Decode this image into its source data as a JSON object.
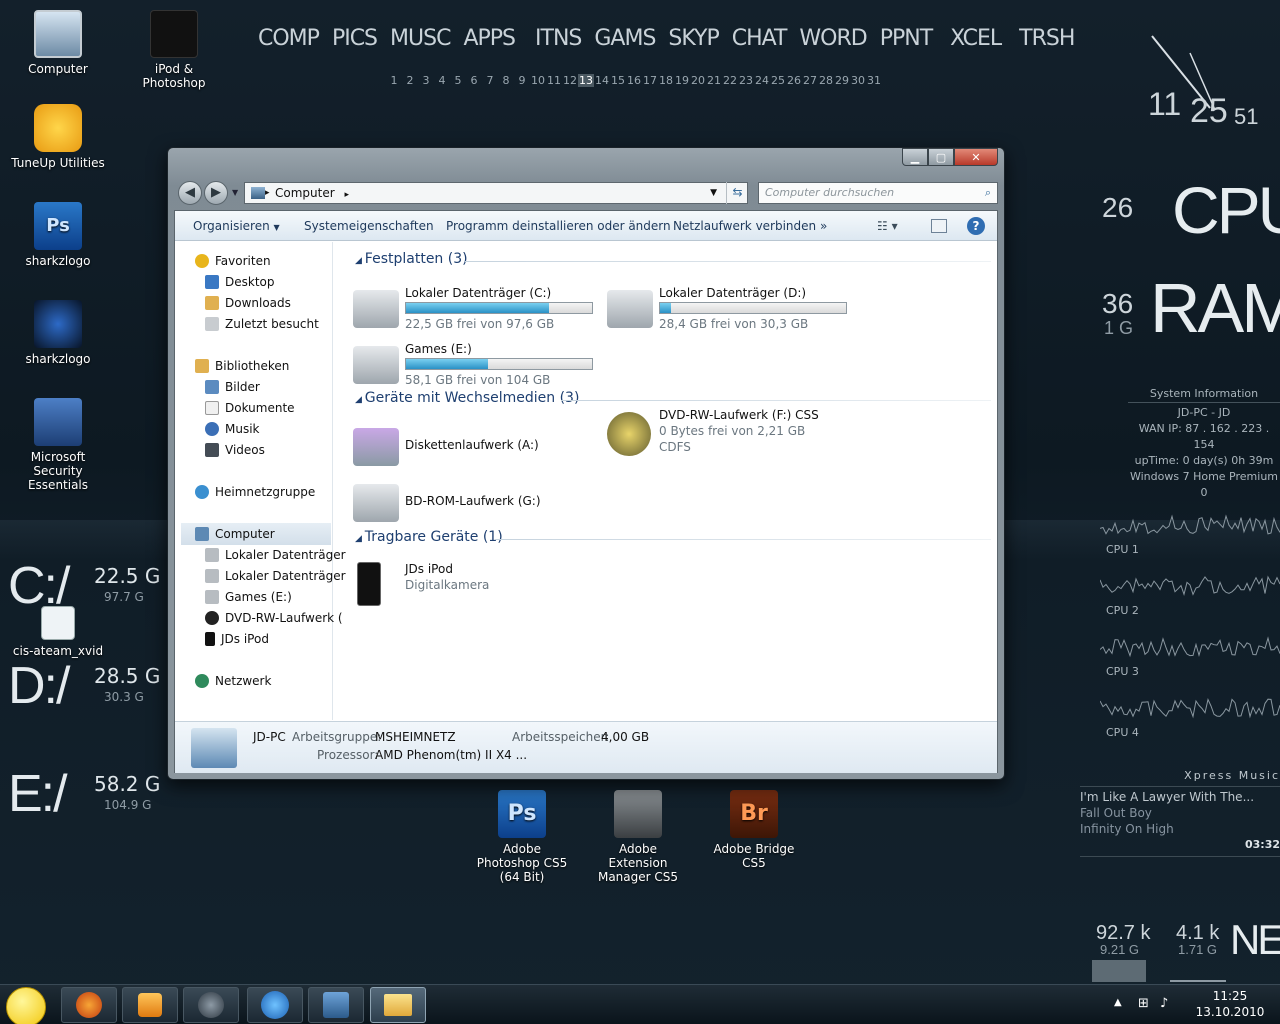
{
  "desktop_icons": [
    {
      "label": "Computer"
    },
    {
      "label": "iPod & Photoshop"
    },
    {
      "label": "TuneUp Utilities"
    },
    {
      "label": "sharkzlogo"
    },
    {
      "label": "sharkzlogo"
    },
    {
      "label": "Microsoft Security Essentials"
    },
    {
      "label": "cis-ateam_xvid"
    },
    {
      "label": "Adobe Photoshop CS5 (64 Bit)"
    },
    {
      "label": "Adobe Extension Manager CS5"
    },
    {
      "label": "Adobe Bridge CS5"
    }
  ],
  "topnav": [
    "COMP",
    "PICS",
    "MUSC",
    "APPS",
    "ITNS",
    "GAMS",
    "SKYP",
    "CHAT",
    "WORD",
    "PPNT",
    "XCEL",
    "TRSH"
  ],
  "days": [
    "1",
    "2",
    "3",
    "4",
    "5",
    "6",
    "7",
    "8",
    "9",
    "10",
    "11",
    "12",
    "13",
    "14",
    "15",
    "16",
    "17",
    "18",
    "19",
    "20",
    "21",
    "22",
    "23",
    "24",
    "25",
    "26",
    "27",
    "28",
    "29",
    "30",
    "31"
  ],
  "today": "13",
  "clock": {
    "hour": "11",
    "minute": "25",
    "second": "51"
  },
  "gauges": {
    "cpu_value": "26",
    "cpu_label": "CPU",
    "ram_value": "36",
    "ram_total": "1 G",
    "ram_label": "RAM"
  },
  "sysinfo": {
    "header": "System Information",
    "host": "JD-PC - JD",
    "wan": "WAN IP: 87 . 162 . 223 . 154",
    "uptime": "upTime: 0 day(s) 0h 39m",
    "os": "Windows 7 Home Premium",
    "extra": "0"
  },
  "cpu_graphs": [
    "CPU 1",
    "CPU 2",
    "CPU 3",
    "CPU 4"
  ],
  "music": {
    "header": "Xpress Music",
    "track": "I'm Like A Lawyer With The...",
    "artist": "Fall Out Boy",
    "album": "Infinity On High",
    "time": "03:32"
  },
  "net": {
    "down": "92.7 k",
    "down_total": "9.21 G",
    "up": "4.1 k",
    "up_total": "1.71 G",
    "label": "NET"
  },
  "drives_widget": [
    {
      "letter": "C:/",
      "free": "22.5 G",
      "total": "97.7 G"
    },
    {
      "letter": "D:/",
      "free": "28.5 G",
      "total": "30.3 G"
    },
    {
      "letter": "E:/",
      "free": "58.2 G",
      "total": "104.9 G"
    }
  ],
  "explorer": {
    "address": "Computer",
    "search_placeholder": "Computer durchsuchen",
    "toolbar": [
      "Organisieren",
      "Systemeigenschaften",
      "Programm deinstallieren oder ändern",
      "Netzlaufwerk verbinden",
      "»"
    ],
    "nav": {
      "favorites": "Favoriten",
      "fav_items": [
        "Desktop",
        "Downloads",
        "Zuletzt besucht"
      ],
      "libraries": "Bibliotheken",
      "lib_items": [
        "Bilder",
        "Dokumente",
        "Musik",
        "Videos"
      ],
      "homegroup": "Heimnetzgruppe",
      "computer": "Computer",
      "comp_items": [
        "Lokaler Datenträger",
        "Lokaler Datenträger",
        "Games (E:)",
        "DVD-RW-Laufwerk (",
        "JDs iPod"
      ],
      "network": "Netzwerk"
    },
    "groups": {
      "hdd": "Festplatten (3)",
      "removable": "Geräte mit Wechselmedien (3)",
      "portable": "Tragbare Geräte (1)"
    },
    "hdds": [
      {
        "name": "Lokaler Datenträger (C:)",
        "free": "22,5 GB frei von 97,6 GB",
        "used_fraction": 0.77
      },
      {
        "name": "Lokaler Datenträger (D:)",
        "free": "28,4 GB frei von 30,3 GB",
        "used_fraction": 0.06
      },
      {
        "name": "Games (E:)",
        "free": "58,1 GB frei von 104 GB",
        "used_fraction": 0.44
      }
    ],
    "removables": [
      {
        "name": "Diskettenlaufwerk (A:)"
      },
      {
        "name": "DVD-RW-Laufwerk (F:) CSS",
        "line2": "0 Bytes frei von 2,21 GB",
        "line3": "CDFS"
      },
      {
        "name": "BD-ROM-Laufwerk (G:)"
      }
    ],
    "portable": {
      "name": "JDs iPod",
      "type": "Digitalkamera"
    },
    "details": {
      "pc": "JD-PC",
      "wg_label": "Arbeitsgruppe:",
      "wg": "MSHEIMNETZ",
      "mem_label": "Arbeitsspeicher:",
      "mem": "4,00 GB",
      "cpu_label": "Prozessor:",
      "cpu": "AMD Phenom(tm) II X4 ..."
    }
  },
  "tray": {
    "time": "11:25",
    "date": "13.10.2010"
  }
}
